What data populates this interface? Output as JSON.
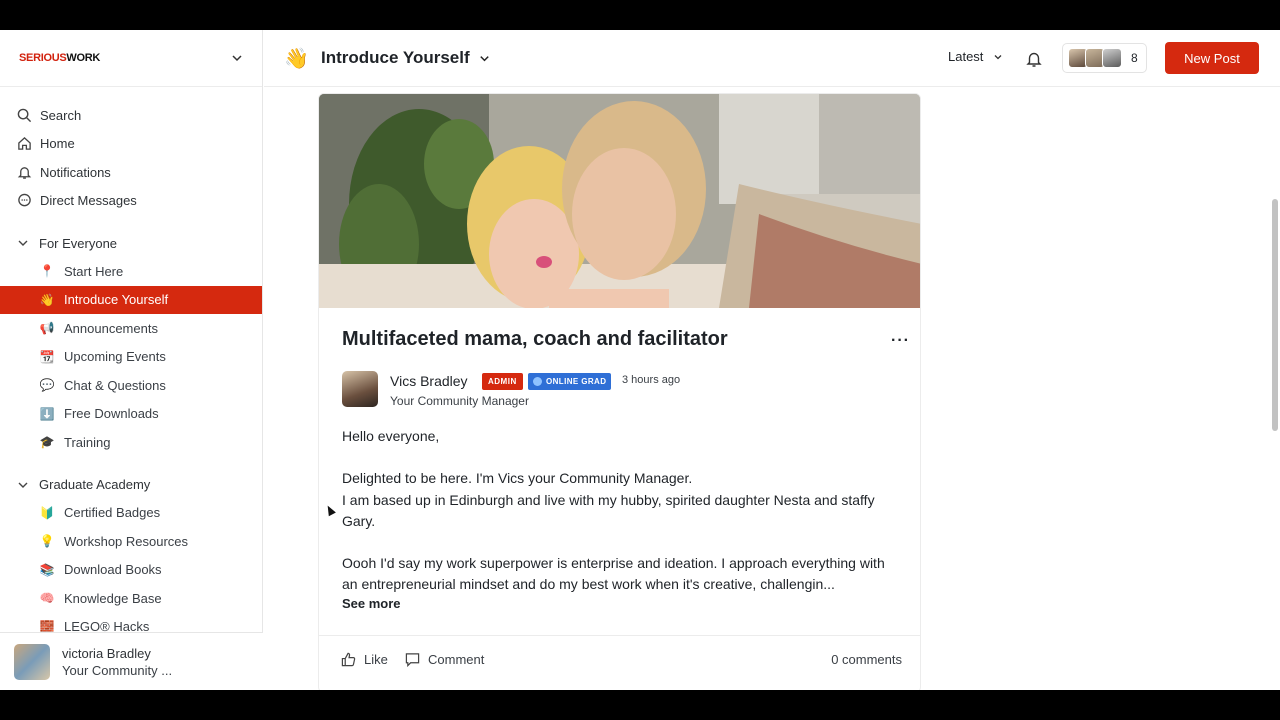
{
  "brand": {
    "part1": "SERIOUS",
    "part2": "WORK"
  },
  "nav": [
    {
      "label": "Search",
      "icon": "search-icon"
    },
    {
      "label": "Home",
      "icon": "home-icon"
    },
    {
      "label": "Notifications",
      "icon": "bell-icon"
    },
    {
      "label": "Direct Messages",
      "icon": "chat-bubble-icon"
    }
  ],
  "sections": [
    {
      "title": "For Everyone",
      "spaces": [
        {
          "emoji": "📍",
          "label": "Start Here"
        },
        {
          "emoji": "👋",
          "label": "Introduce Yourself",
          "active": true
        },
        {
          "emoji": "📢",
          "label": "Announcements"
        },
        {
          "emoji": "📆",
          "label": "Upcoming Events"
        },
        {
          "emoji": "💬",
          "label": "Chat & Questions"
        },
        {
          "emoji": "⬇️",
          "label": "Free Downloads"
        },
        {
          "emoji": "🎓",
          "label": "Training"
        }
      ]
    },
    {
      "title": "Graduate Academy",
      "spaces": [
        {
          "emoji": "🔰",
          "label": "Certified Badges"
        },
        {
          "emoji": "💡",
          "label": "Workshop Resources"
        },
        {
          "emoji": "📚",
          "label": "Download Books"
        },
        {
          "emoji": "🧠",
          "label": "Knowledge Base"
        },
        {
          "emoji": "🧱",
          "label": "LEGO® Hacks"
        }
      ]
    }
  ],
  "current_user": {
    "name": "victoria Bradley",
    "subtitle": "Your Community ..."
  },
  "header": {
    "emoji": "👋",
    "title": "Introduce Yourself",
    "sort_label": "Latest",
    "member_count": "8",
    "new_post_label": "New Post"
  },
  "post": {
    "title": "Multifaceted mama, coach and facilitator",
    "menu": "···",
    "author": "Vics Bradley",
    "badge_admin": "ADMIN",
    "badge_grad": "ONLINE GRAD",
    "time": "3 hours ago",
    "role": "Your Community Manager",
    "body": {
      "p1": "Hello everyone,",
      "p2a": "Delighted to be here. I'm Vics your Community Manager.",
      "p2b": "I am based up in Edinburgh and live with my hubby, spirited daughter Nesta and staffy Gary.",
      "p3": "Oooh I'd say my work superpower is enterprise and ideation. I approach everything with an entrepreneurial mindset and do my best work when it's creative, challengin..."
    },
    "see_more": "See more",
    "like_label": "Like",
    "comment_label": "Comment",
    "comments_count": "0 comments"
  },
  "colors": {
    "accent": "#d5290f",
    "grad_badge": "#2f6fd6"
  }
}
